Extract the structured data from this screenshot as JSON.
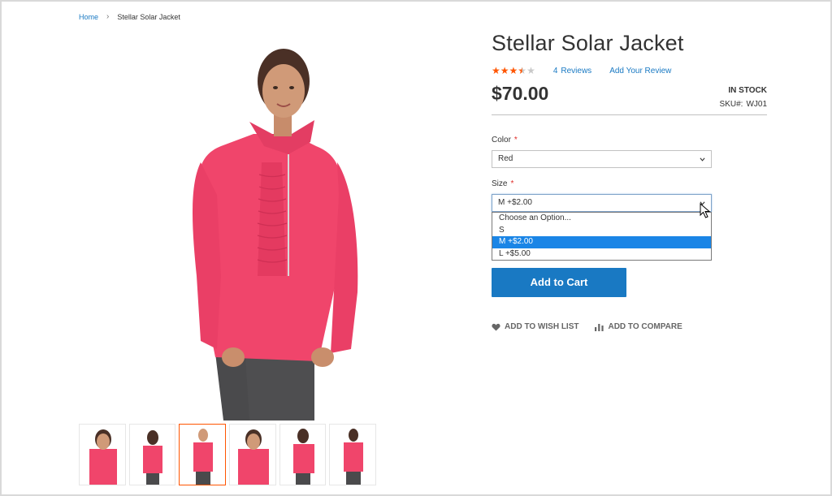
{
  "breadcrumb": {
    "home": "Home",
    "separator": "›",
    "current": "Stellar Solar Jacket"
  },
  "product": {
    "title": "Stellar Solar Jacket",
    "rating": {
      "value": 3.5,
      "max": 5
    },
    "reviews_count": "4",
    "reviews_label": "Reviews",
    "add_review": "Add Your Review",
    "price": "$70.00",
    "stock": "IN STOCK",
    "sku_label": "SKU#:",
    "sku": "WJ01"
  },
  "options": {
    "color": {
      "label": "Color",
      "required_mark": "*",
      "value": "Red"
    },
    "size": {
      "label": "Size",
      "required_mark": "*",
      "value": "M +$2.00",
      "items": [
        "Choose an Option...",
        "S",
        "M +$2.00",
        "L +$5.00"
      ],
      "selected_index": 2
    }
  },
  "cart": {
    "label": "Add to Cart"
  },
  "actions": {
    "wishlist": "ADD TO WISH LIST",
    "compare": "ADD TO COMPARE"
  },
  "gallery": {
    "thumb_count": 6,
    "active_index": 2
  },
  "colors": {
    "accent": "#1979c3",
    "jacket": "#f0456b",
    "active_thumb_border": "#ff5501",
    "star": "#ff5501",
    "dropdown_selected": "#1a85e6"
  }
}
